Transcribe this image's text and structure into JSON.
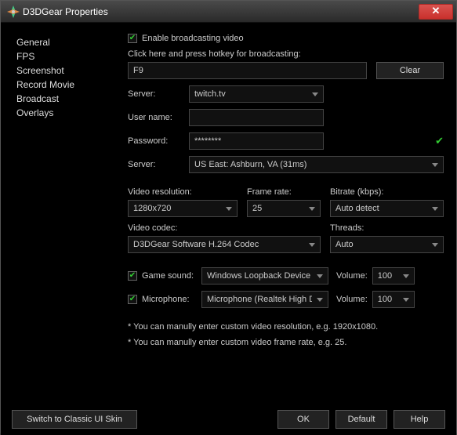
{
  "titlebar": {
    "title": "D3DGear Properties"
  },
  "sidebar": {
    "items": [
      {
        "label": "General"
      },
      {
        "label": "FPS"
      },
      {
        "label": "Screenshot"
      },
      {
        "label": "Record Movie"
      },
      {
        "label": "Broadcast"
      },
      {
        "label": "Overlays"
      }
    ]
  },
  "main": {
    "enable_label": "Enable broadcasting video",
    "hotkey_hint": "Click here and press hotkey for broadcasting:",
    "hotkey_value": "F9",
    "clear_label": "Clear",
    "server_label": "Server:",
    "server_value": "twitch.tv",
    "username_label": "User name:",
    "username_value": "",
    "password_label": "Password:",
    "password_value": "********",
    "region_label": "Server:",
    "region_value": "US East: Ashburn, VA    (31ms)",
    "vres_label": "Video resolution:",
    "vres_value": "1280x720",
    "fps_label": "Frame rate:",
    "fps_value": "25",
    "bitrate_label": "Bitrate (kbps):",
    "bitrate_value": "Auto detect",
    "codec_label": "Video codec:",
    "codec_value": "D3DGear Software H.264 Codec",
    "threads_label": "Threads:",
    "threads_value": "Auto",
    "gamesound_label": "Game sound:",
    "gamesound_value": "Windows Loopback Device",
    "mic_label": "Microphone:",
    "mic_value": "Microphone (Realtek High Defir",
    "volume_label": "Volume:",
    "volume1_value": "100",
    "volume2_value": "100",
    "note1": "* You can manully enter custom video resolution, e.g. 1920x1080.",
    "note2": "* You can manully enter custom video frame rate, e.g. 25."
  },
  "footer": {
    "skin": "Switch to Classic UI Skin",
    "ok": "OK",
    "default": "Default",
    "help": "Help"
  }
}
